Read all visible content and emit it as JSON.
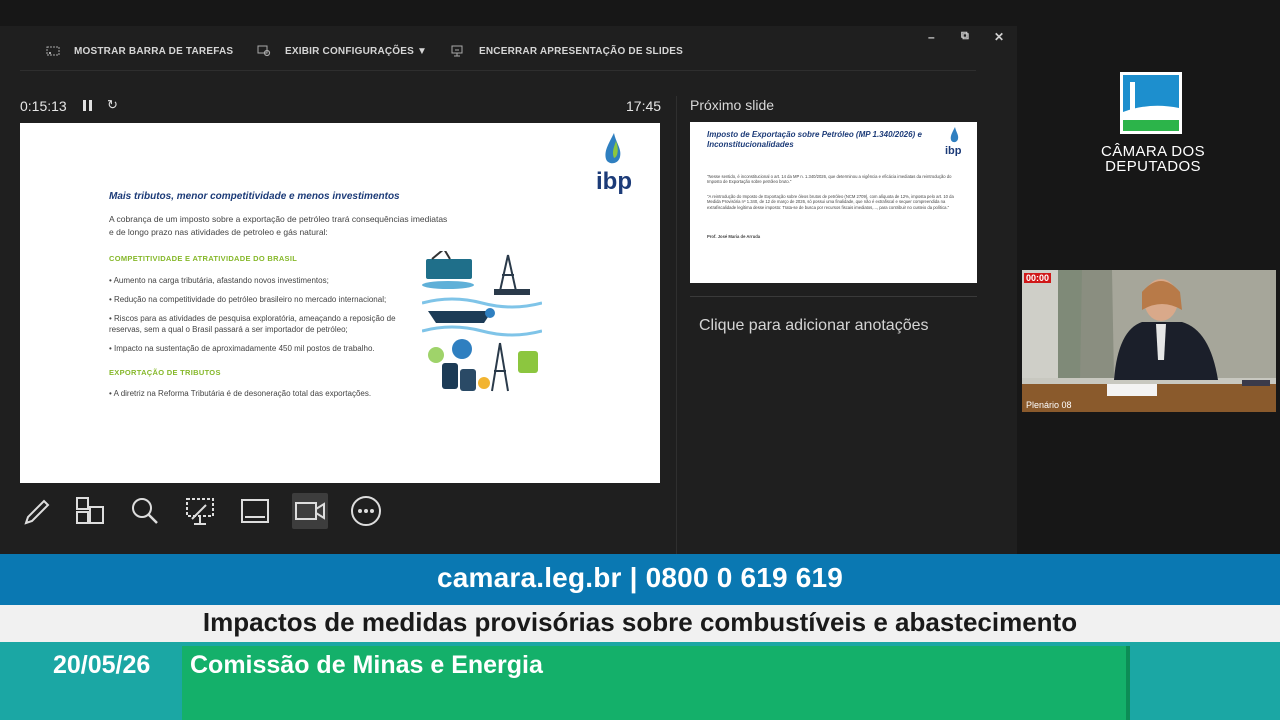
{
  "toolbar": {
    "show_taskbar": "MOSTRAR BARRA DE TAREFAS",
    "display_settings": "EXIBIR CONFIGURAÇÕES ▼",
    "end_slideshow": "ENCERRAR APRESENTAÇÃO DE SLIDES",
    "minimize": "–",
    "restore": "⧉",
    "close": "✕"
  },
  "presenter": {
    "elapsed": "0:15:13",
    "clock": "17:45",
    "next_slide_label": "Próximo slide",
    "notes_placeholder": "Clique para adicionar anotações"
  },
  "current_slide": {
    "logo_text": "ibp",
    "title": "Mais tributos, menor competitividade e menos investimentos",
    "intro": "A cobrança de um imposto sobre a exportação de petróleo trará consequências imediatas e de longo prazo nas atividades de petroleo e gás natural:",
    "section1": "COMPETITIVIDADE E ATRATIVIDADE DO BRASIL",
    "bullets1": [
      "• Aumento na carga tributária, afastando novos investimentos;",
      "• Redução na competitividade do petróleo brasileiro no mercado internacional;",
      "• Riscos para as atividades de pesquisa exploratória, ameaçando a reposição de reservas, sem a qual o Brasil passará a ser importador de petróleo;",
      "• Impacto na sustentação de aproximadamente 450 mil postos de trabalho."
    ],
    "section2": "EXPORTAÇÃO DE TRIBUTOS",
    "bullets2": [
      "• A diretriz na Reforma Tributária é de desoneração total das exportações."
    ]
  },
  "next_slide": {
    "logo_text": "ibp",
    "title": "Imposto de Exportação sobre Petróleo (MP 1.340/2026) e Inconstitucionalidades",
    "para1": "\"Nesse sentido, é inconstitucional o art. 14 da MP n. 1.340/2026, que determinou a vigência e eficácia imediatas da reintrodução do Imposto de Exportação sobre petróleo bruto.\"",
    "para2": "\"A reintrodução do Imposto de Exportação sobre óleos brutos de petróleo (NCM 2709), com alíquota de 12%, imposta pelo art. 10 da Medida Provisória nº 1.340, de 12 de março de 2026, só possui uma finalidade, que não é extrafiscal e sequer compreendida na extrafiscalidade legítima desse imposto: Trata-se de busca por recursos fiscais imediatos,..., para contribuir no custeio da política.\"",
    "author": "Prof. José Maria de Arruda"
  },
  "broadcast": {
    "logo_line1": "CÂMARA DOS",
    "logo_line2": "DEPUTADOS",
    "rec_label": "00:00",
    "room": "Plenário 08",
    "contact": "camara.leg.br | 0800 0 619 619",
    "headline": "Impactos de medidas provisórias sobre combustíveis e abastecimento",
    "date": "20/05/26",
    "commission": "Comissão de Minas e Energia"
  },
  "colors": {
    "blue_bar": "#0a78b2",
    "green_bar": "#14b06a",
    "teal_bar": "#1ba7a4",
    "slide_title": "#1c3b78",
    "slide_section": "#86b82b"
  }
}
